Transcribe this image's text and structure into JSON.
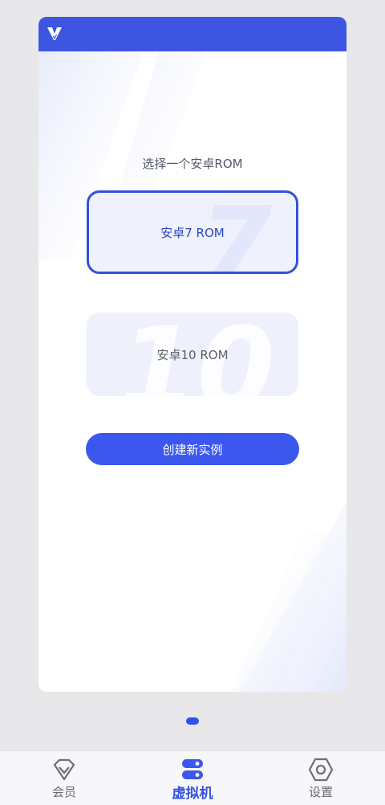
{
  "main": {
    "prompt": "选择一个安卓ROM",
    "options": [
      {
        "label": "安卓7 ROM",
        "selected": true
      },
      {
        "label": "安卓10 ROM",
        "selected": false
      }
    ],
    "create_button": "创建新实例"
  },
  "pager": {
    "pages": 1,
    "current": 1
  },
  "bottom_nav": {
    "items": [
      {
        "label": "会员",
        "icon": "diamond-icon"
      },
      {
        "label": "虚拟机",
        "icon": "server-icon",
        "active": true
      },
      {
        "label": "设置",
        "icon": "hexagon-gear-icon"
      }
    ]
  },
  "colors": {
    "accent": "#3b57ee",
    "header": "#3d55e0",
    "option_bg": "#eef1fb"
  }
}
